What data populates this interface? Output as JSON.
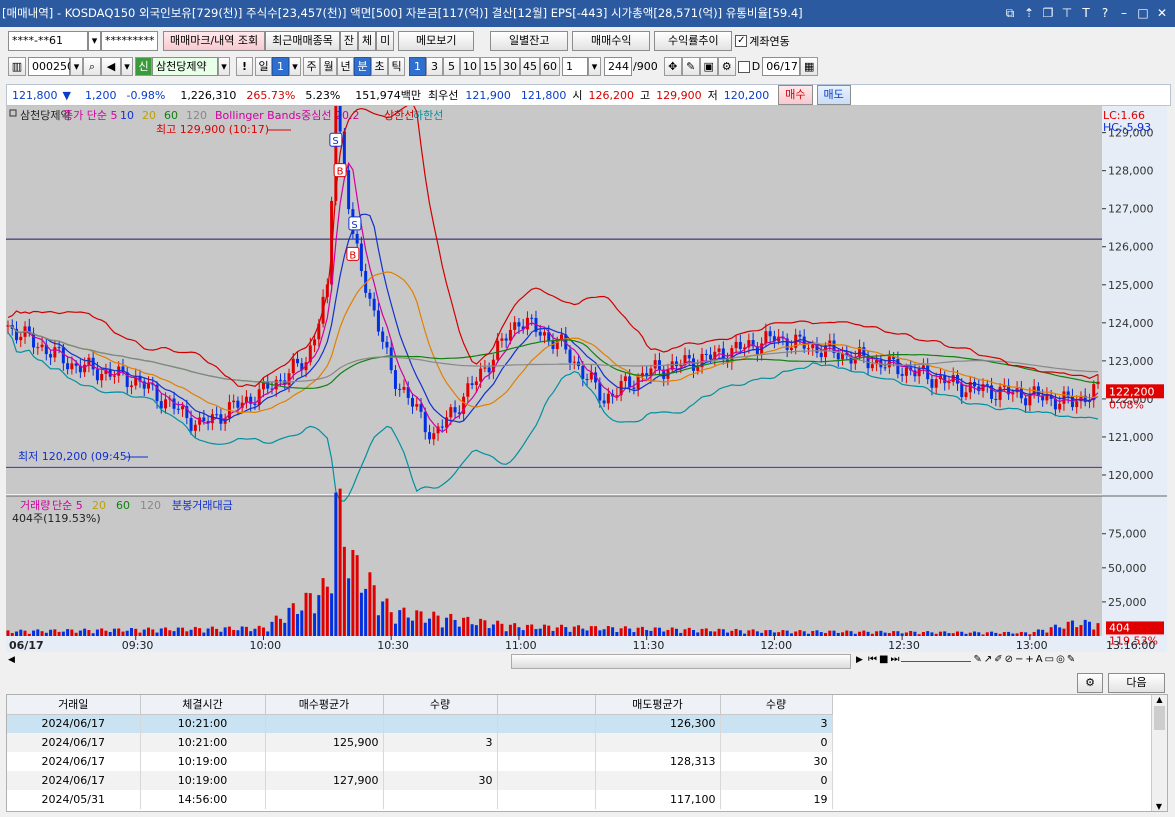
{
  "title": "[매매내역] - KOSDAQ150 외국인보유[729(천)] 주식수[23,457(천)] 액면[500] 자본금[117(억)] 결산[12월] EPS[-443] 시가총액[28,571(억)] 유통비율[59.4]",
  "title_icons": [
    "restore-icon",
    "pin-icon",
    "window-icon",
    "fix-icon",
    "text-icon",
    "help-icon",
    "minimize-icon",
    "maximize-icon",
    "close-icon"
  ],
  "toolbar1": {
    "account": "****-**61",
    "password": "*********",
    "mark_btn": "매매마크/내역 조회",
    "recent_btn": "최근매매종목",
    "jan": "잔",
    "che": "체",
    "mi": "미",
    "memo_btn": "메모보기",
    "daily_btn": "일별잔고",
    "period_btn": "매매수익",
    "rate_btn": "수익률추이",
    "link_label": "계좌연동"
  },
  "toolbar2": {
    "code": "000250",
    "sin": "신",
    "name": "삼천당제약",
    "excl": "!",
    "day": "일",
    "day_n": "1",
    "periods": [
      "주",
      "월",
      "년",
      "분",
      "초",
      "틱"
    ],
    "intervals": [
      "1",
      "3",
      "5",
      "10",
      "15",
      "30",
      "45",
      "60"
    ],
    "n": "1",
    "count": "244",
    "count_total": "/900",
    "d_label": "D",
    "date": "06/17"
  },
  "quote": {
    "price": "121,800",
    "change": "1,200",
    "rate": "-0.98%",
    "volume": "1,226,310",
    "vol_rate": "265.73%",
    "turnover": "5.23%",
    "amount": "151,974백만",
    "best_label": "최우선",
    "best_bid": "121,900",
    "best_ask": "121,800",
    "open_label": "시",
    "open": "126,200",
    "high_label": "고",
    "high": "129,900",
    "low_label": "저",
    "low": "120,200",
    "buy": "매수",
    "sell": "매도"
  },
  "chart_data": [
    {
      "type": "line",
      "legend": [
        "삼천당제약",
        "종가 단순 5",
        "10",
        "20",
        "60",
        "120",
        "Bollinger Bands중심선 20.2",
        "상한선",
        "하한선"
      ],
      "top_right": [
        "LC:1.66",
        "HC:-5.93"
      ],
      "high_note": "최고 129,900 (10:17)",
      "low_note": "최저 120,200 (09:45)",
      "ylim": [
        119500,
        129700
      ],
      "yticks": [
        "129,000",
        "128,000",
        "127,000",
        "126,000",
        "125,000",
        "124,000",
        "123,000",
        "122,000",
        "121,000",
        "120,000"
      ],
      "last_price_tag": "122,200",
      "last_rate_tag": "0.08%",
      "hlines": [
        129900,
        126200,
        120200
      ],
      "trade_marks": [
        "S",
        "B",
        "S",
        "B"
      ],
      "x": [
        "09:00",
        "09:15",
        "09:30",
        "09:45",
        "10:00",
        "10:10",
        "10:15",
        "10:17",
        "10:21",
        "10:30",
        "10:40",
        "10:50",
        "11:00",
        "11:10",
        "11:20",
        "11:30",
        "11:45",
        "12:00",
        "12:15",
        "12:30",
        "12:45",
        "13:00",
        "13:10",
        "13:15"
      ],
      "close": [
        123900,
        122900,
        122500,
        121300,
        122200,
        123000,
        124800,
        129900,
        126200,
        122700,
        121000,
        122500,
        124100,
        123400,
        122000,
        122700,
        123100,
        123600,
        123200,
        122800,
        122300,
        122100,
        121900,
        122200
      ]
    },
    {
      "type": "bar",
      "legend": [
        "거래량",
        "단순 5",
        "20",
        "60",
        "120",
        "분봉거래대금"
      ],
      "label": "404주(119.53%)",
      "ylim": [
        0,
        88000
      ],
      "yticks": [
        "75,000",
        "50,000",
        "25,000"
      ],
      "last_tag": "404",
      "last_rate_tag": "119.53%",
      "x": [
        "09:00",
        "09:30",
        "10:00",
        "10:15",
        "10:17",
        "10:21",
        "10:30",
        "11:00",
        "12:00",
        "13:00",
        "13:10"
      ],
      "values": [
        3000,
        4000,
        5000,
        30000,
        82000,
        45000,
        15000,
        6000,
        3000,
        2000,
        8000
      ]
    }
  ],
  "xaxis": [
    "06/17",
    "09:30",
    "10:00",
    "10:30",
    "11:00",
    "11:30",
    "12:00",
    "12:30",
    "13:00",
    "13:16:00"
  ],
  "bottom_btns": {
    "settings": "⚙",
    "next": "다음"
  },
  "table": {
    "headers": [
      "거래일",
      "체결시간",
      "매수평균가",
      "수량",
      "",
      "매도평균가",
      "수량"
    ],
    "rows": [
      [
        "2024/06/17",
        "10:21:00",
        "",
        "",
        "",
        "126,300",
        "3"
      ],
      [
        "2024/06/17",
        "10:21:00",
        "125,900",
        "3",
        "",
        "",
        "0"
      ],
      [
        "2024/06/17",
        "10:19:00",
        "",
        "",
        "",
        "128,313",
        "30"
      ],
      [
        "2024/06/17",
        "10:19:00",
        "127,900",
        "30",
        "",
        "",
        "0"
      ],
      [
        "2024/05/31",
        "14:56:00",
        "",
        "",
        "",
        "117,100",
        "19"
      ]
    ]
  }
}
